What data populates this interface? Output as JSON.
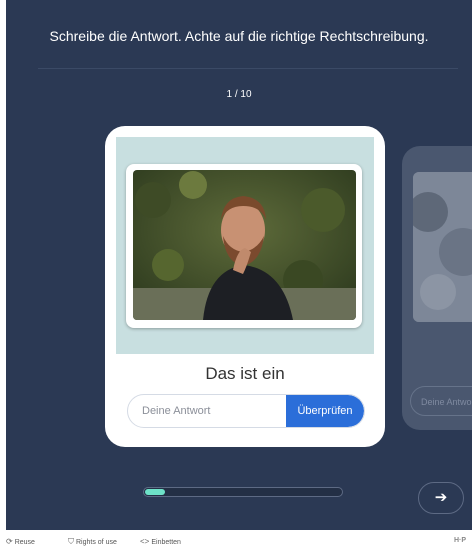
{
  "instruction": "Schreibe die Antwort. Achte auf die richtige Rechtschreibung.",
  "counter": "1 / 10",
  "card": {
    "label": "Das ist ein",
    "answer_placeholder": "Deine Antwort",
    "check_button": "Überprüfen"
  },
  "next_card": {
    "answer_placeholder": "Deine Antwort"
  },
  "progress": {
    "fraction": 0.1
  },
  "footer": {
    "reuse": "Reuse",
    "rights": "Rights of use",
    "embed": "Einbetten",
    "brand": "H·P"
  },
  "colors": {
    "background": "#2b3954",
    "card_top": "#c8dfe0",
    "accent": "#2b6ed9",
    "progress_fill": "#6ee2c8"
  },
  "icons": [
    "reuse-icon",
    "rights-icon",
    "embed-icon",
    "arrow-right-icon"
  ]
}
